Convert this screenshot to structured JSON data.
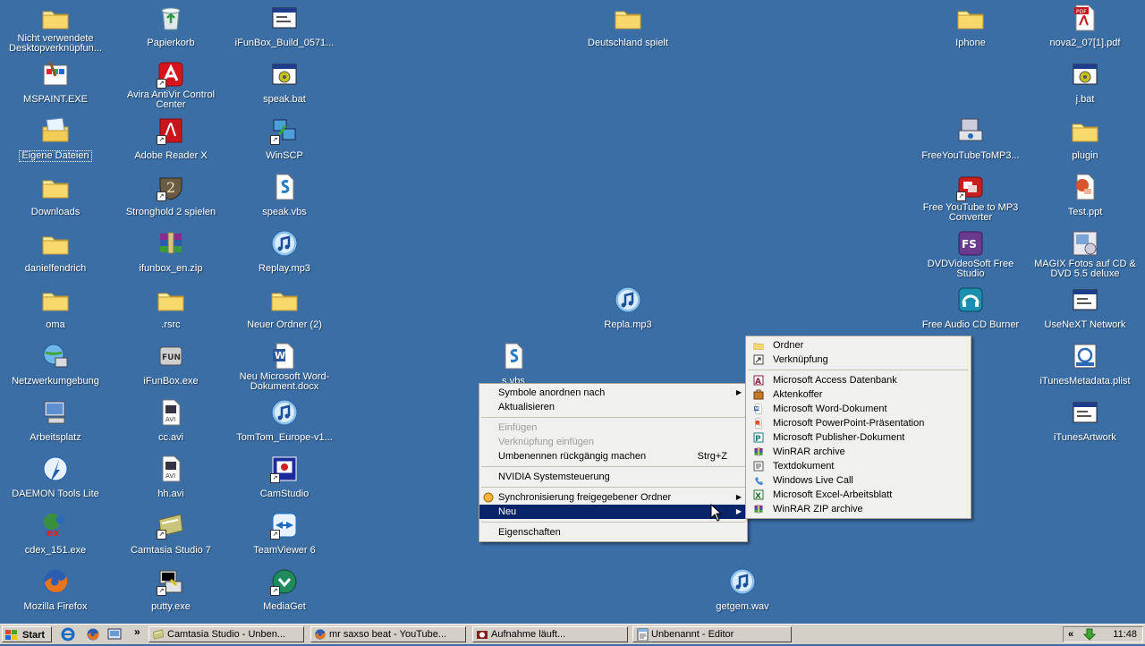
{
  "desktop_icons": [
    {
      "label": "Nicht verwendete Desktopverknüpfun...",
      "icon": "folder-icon",
      "col": 0,
      "row": 0
    },
    {
      "label": "MSPAINT.EXE",
      "icon": "paint-icon",
      "col": 0,
      "row": 1
    },
    {
      "label": "Eigene Dateien",
      "icon": "my-documents-icon",
      "col": 0,
      "row": 2,
      "selected": true
    },
    {
      "label": "Downloads",
      "icon": "folder-icon",
      "col": 0,
      "row": 3
    },
    {
      "label": "danielfendrich",
      "icon": "folder-icon",
      "col": 0,
      "row": 4
    },
    {
      "label": "oma",
      "icon": "folder-icon",
      "col": 0,
      "row": 5
    },
    {
      "label": "Netzwerkumgebung",
      "icon": "network-icon",
      "col": 0,
      "row": 6
    },
    {
      "label": "Arbeitsplatz",
      "icon": "computer-icon",
      "col": 0,
      "row": 7
    },
    {
      "label": "DAEMON Tools Lite",
      "icon": "daemon-tools-icon",
      "col": 0,
      "row": 8
    },
    {
      "label": "cdex_151.exe",
      "icon": "cdex-icon",
      "col": 0,
      "row": 9
    },
    {
      "label": "Mozilla Firefox",
      "icon": "firefox-icon",
      "col": 0,
      "row": 10
    },
    {
      "label": "Papierkorb",
      "icon": "recycle-bin-icon",
      "col": 1,
      "row": 0
    },
    {
      "label": "Avira AntiVir Control Center",
      "icon": "avira-icon",
      "col": 1,
      "row": 1,
      "shortcut": true
    },
    {
      "label": "Adobe Reader X",
      "icon": "pdf-icon",
      "col": 1,
      "row": 2,
      "shortcut": true
    },
    {
      "label": "Stronghold 2 spielen",
      "icon": "stronghold-icon",
      "col": 1,
      "row": 3,
      "shortcut": true
    },
    {
      "label": "ifunbox_en.zip",
      "icon": "winrar-icon",
      "col": 1,
      "row": 4
    },
    {
      "label": ".rsrc",
      "icon": "folder-icon",
      "col": 1,
      "row": 5
    },
    {
      "label": "iFunBox.exe",
      "icon": "ifunbox-icon",
      "col": 1,
      "row": 6
    },
    {
      "label": "cc.avi",
      "icon": "avi-icon",
      "col": 1,
      "row": 7
    },
    {
      "label": "hh.avi",
      "icon": "avi-icon",
      "col": 1,
      "row": 8
    },
    {
      "label": "Camtasia Studio 7",
      "icon": "camtasia-icon",
      "col": 1,
      "row": 9,
      "shortcut": true
    },
    {
      "label": "putty.exe",
      "icon": "putty-icon",
      "col": 1,
      "row": 10,
      "shortcut": true
    },
    {
      "label": "iFunBox_Build_0571...",
      "icon": "exe-window-icon",
      "col": 2,
      "row": 0
    },
    {
      "label": "speak.bat",
      "icon": "bat-icon",
      "col": 2,
      "row": 1
    },
    {
      "label": "WinSCP",
      "icon": "winscp-icon",
      "col": 2,
      "row": 2,
      "shortcut": true
    },
    {
      "label": "speak.vbs",
      "icon": "vbs-icon",
      "col": 2,
      "row": 3
    },
    {
      "label": "Replay.mp3",
      "icon": "music-icon",
      "col": 2,
      "row": 4
    },
    {
      "label": "Neuer Ordner (2)",
      "icon": "folder-icon",
      "col": 2,
      "row": 5
    },
    {
      "label": "Neu Microsoft Word-Dokument.docx",
      "icon": "word-icon",
      "col": 2,
      "row": 6
    },
    {
      "label": "TomTom_Europe-v1...",
      "icon": "music-icon",
      "col": 2,
      "row": 7
    },
    {
      "label": "CamStudio",
      "icon": "camstudio-icon",
      "col": 2,
      "row": 8,
      "shortcut": true
    },
    {
      "label": "TeamViewer 6",
      "icon": "teamviewer-icon",
      "col": 2,
      "row": 9,
      "shortcut": true
    },
    {
      "label": "MediaGet",
      "icon": "mediaget-icon",
      "col": 2,
      "row": 10,
      "shortcut": true
    },
    {
      "label": "Deutschland spielt",
      "icon": "folder-icon",
      "col": "deutschland",
      "row": 0
    },
    {
      "label": "Repla.mp3",
      "icon": "music-icon",
      "col": "repla",
      "row": 5
    },
    {
      "label": "s.vbs",
      "icon": "vbs-icon",
      "col": "svbs",
      "row": 6
    },
    {
      "label": "getgem.wav",
      "icon": "music-icon",
      "col": "getgem",
      "row": 10
    },
    {
      "label": "Iphone",
      "icon": "folder-icon",
      "col": "r1",
      "row": 0
    },
    {
      "label": "FreeYouTubeToMP3...",
      "icon": "youtube-mp3-icon",
      "col": "r1",
      "row": 2
    },
    {
      "label": "Free YouTube to MP3 Converter",
      "icon": "youtube-red-icon",
      "col": "r1",
      "row": 3,
      "shortcut": true
    },
    {
      "label": "DVDVideoSoft Free Studio",
      "icon": "dvdvideosoft-icon",
      "col": "r1",
      "row": 4
    },
    {
      "label": "Free Audio CD Burner",
      "icon": "cd-burner-icon",
      "col": "r1",
      "row": 5
    },
    {
      "label": "nova2_07[1].pdf",
      "icon": "pdf-file-icon",
      "col": "r2",
      "row": 0
    },
    {
      "label": "j.bat",
      "icon": "bat-icon",
      "col": "r2",
      "row": 1
    },
    {
      "label": "plugin",
      "icon": "folder-icon",
      "col": "r2",
      "row": 2
    },
    {
      "label": "Test.ppt",
      "icon": "ppt-icon",
      "col": "r2",
      "row": 3
    },
    {
      "label": "MAGIX Fotos auf CD & DVD 5.5 deluxe",
      "icon": "magix-icon",
      "col": "r2",
      "row": 4
    },
    {
      "label": "UseNeXT Network",
      "icon": "exe-window-icon",
      "col": "r2",
      "row": 5
    },
    {
      "label": "iTunesMetadata.plist",
      "icon": "plist-icon",
      "col": "r2",
      "row": 6
    },
    {
      "label": "iTunesArtwork",
      "icon": "exe-window-icon",
      "col": "r2",
      "row": 7
    }
  ],
  "context_menu": [
    {
      "label": "Symbole anordnen nach",
      "submenu": true
    },
    {
      "label": "Aktualisieren"
    },
    {
      "separator": true
    },
    {
      "label": "Einfügen",
      "disabled": true
    },
    {
      "label": "Verknüpfung einfügen",
      "disabled": true
    },
    {
      "label": "Umbenennen rückgängig machen",
      "shortcut": "Strg+Z"
    },
    {
      "separator": true
    },
    {
      "label": "NVIDIA Systemsteuerung"
    },
    {
      "separator": true
    },
    {
      "label": "Synchronisierung freigegebener Ordner",
      "submenu": true,
      "icon": "sync-icon"
    },
    {
      "label": "Neu",
      "submenu": true,
      "highlighted": true
    },
    {
      "separator": true
    },
    {
      "label": "Eigenschaften"
    }
  ],
  "new_submenu": [
    {
      "label": "Ordner",
      "icon": "folder-icon"
    },
    {
      "label": "Verknüpfung",
      "icon": "shortcut-icon"
    },
    {
      "separator": true
    },
    {
      "label": "Microsoft Access Datenbank",
      "icon": "access-icon"
    },
    {
      "label": "Aktenkoffer",
      "icon": "briefcase-icon"
    },
    {
      "label": "Microsoft Word-Dokument",
      "icon": "word-icon"
    },
    {
      "label": "Microsoft PowerPoint-Präsentation",
      "icon": "ppt-icon"
    },
    {
      "label": "Microsoft Publisher-Dokument",
      "icon": "publisher-icon"
    },
    {
      "label": "WinRAR archive",
      "icon": "winrar-icon"
    },
    {
      "label": "Textdokument",
      "icon": "text-icon"
    },
    {
      "label": "Windows Live Call",
      "icon": "live-call-icon"
    },
    {
      "label": "Microsoft Excel-Arbeitsblatt",
      "icon": "excel-icon"
    },
    {
      "label": "WinRAR ZIP archive",
      "icon": "winrar-icon"
    }
  ],
  "taskbar": {
    "start_label": "Start",
    "quicklaunch": [
      "ie-icon",
      "firefox-icon",
      "show-desktop-icon"
    ],
    "chevron": "»",
    "tasks": [
      {
        "label": "Camtasia Studio - Unben...",
        "icon": "camtasia-icon"
      },
      {
        "label": "mr saxso beat - YouTube...",
        "icon": "firefox-icon"
      },
      {
        "label": "Aufnahme läuft...",
        "icon": "record-icon"
      },
      {
        "label": "Unbenannt - Editor",
        "icon": "notepad-icon"
      }
    ],
    "tray_chevron": "«",
    "clock": "11:48"
  },
  "colors": {
    "desktop": "#3a6ea5",
    "menu_bg": "#f0f0ee",
    "highlight": "#0a246a",
    "taskbar": "#d4d0c8"
  }
}
